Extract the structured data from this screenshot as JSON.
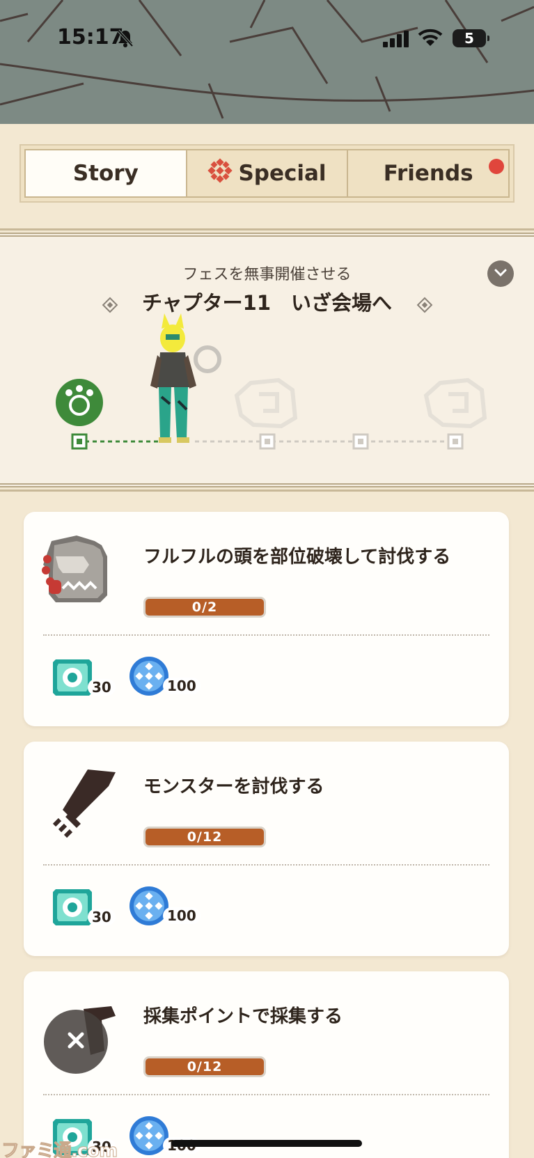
{
  "status_bar": {
    "time": "15:17",
    "battery": "5",
    "icons": [
      "bell-muted-icon",
      "signal-icon",
      "wifi-icon",
      "battery-icon"
    ]
  },
  "tabs": [
    {
      "label": "Story",
      "active": true
    },
    {
      "label": "Special",
      "icon": "special-icon",
      "active": false
    },
    {
      "label": "Friends",
      "notification": true,
      "active": false
    }
  ],
  "chapter": {
    "subtitle": "フェスを無事開催させる",
    "title": "チャプター11　いざ会場へ"
  },
  "missions": [
    {
      "title": "フルフルの頭を部位破壊して討伐する",
      "icon": "khezu-monster-icon",
      "progress": "0/2",
      "rewards": [
        {
          "icon": "ticket-gem-icon",
          "count": "30"
        },
        {
          "icon": "blue-orb-icon",
          "count": "100"
        }
      ]
    },
    {
      "title": "モンスターを討伐する",
      "icon": "sword-icon",
      "progress": "0/12",
      "rewards": [
        {
          "icon": "ticket-gem-icon",
          "count": "30"
        },
        {
          "icon": "blue-orb-icon",
          "count": "100"
        }
      ]
    },
    {
      "title": "採集ポイントで採集する",
      "icon": "gather-icon",
      "progress": "0/12",
      "rewards": [
        {
          "icon": "ticket-gem-icon",
          "count": "30"
        },
        {
          "icon": "blue-orb-icon",
          "count": "100"
        }
      ]
    }
  ],
  "watermark": "ファミ通.com",
  "colors": {
    "background": "#f3e8d2",
    "progress_fill": "#b75e27",
    "notify": "#e0463c",
    "green_node": "#3e8a3a"
  }
}
